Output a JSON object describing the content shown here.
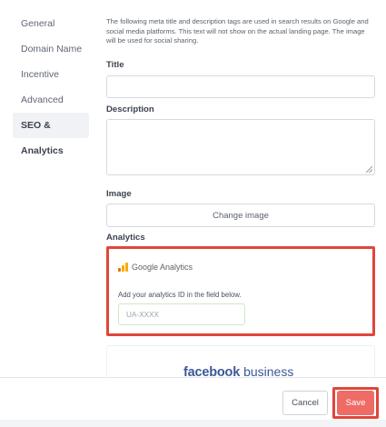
{
  "sidebar": {
    "items": [
      {
        "label": "General"
      },
      {
        "label": "Domain Name"
      },
      {
        "label": "Incentive"
      },
      {
        "label": "Advanced"
      },
      {
        "label": "SEO & Analytics",
        "active": true
      }
    ]
  },
  "seo": {
    "intro": "The following meta title and description tags are used in search results on Google and social media platforms. This text will not show on the actual landing page. The image will be used for social sharing.",
    "title_label": "Title",
    "title_value": "",
    "description_label": "Description",
    "description_value": "",
    "image_label": "Image",
    "change_image_label": "Change image"
  },
  "analytics": {
    "heading": "Analytics",
    "provider_logo_text": "Google Analytics",
    "hint": "Add your analytics ID in the field below.",
    "id_placeholder": "UA-XXXX",
    "id_value": ""
  },
  "facebook": {
    "brand": "facebook",
    "suffix": "business"
  },
  "footer": {
    "cancel_label": "Cancel",
    "save_label": "Save"
  },
  "colors": {
    "accent_red": "#e0463a",
    "save_button": "#ef6b66",
    "ga_orange": "#f9ab00",
    "ga_dark_orange": "#e37400",
    "facebook_blue": "#3b5998"
  },
  "icons": {
    "google_analytics": "google-analytics-logo-icon",
    "textarea_resize": "resize-grip-icon"
  }
}
